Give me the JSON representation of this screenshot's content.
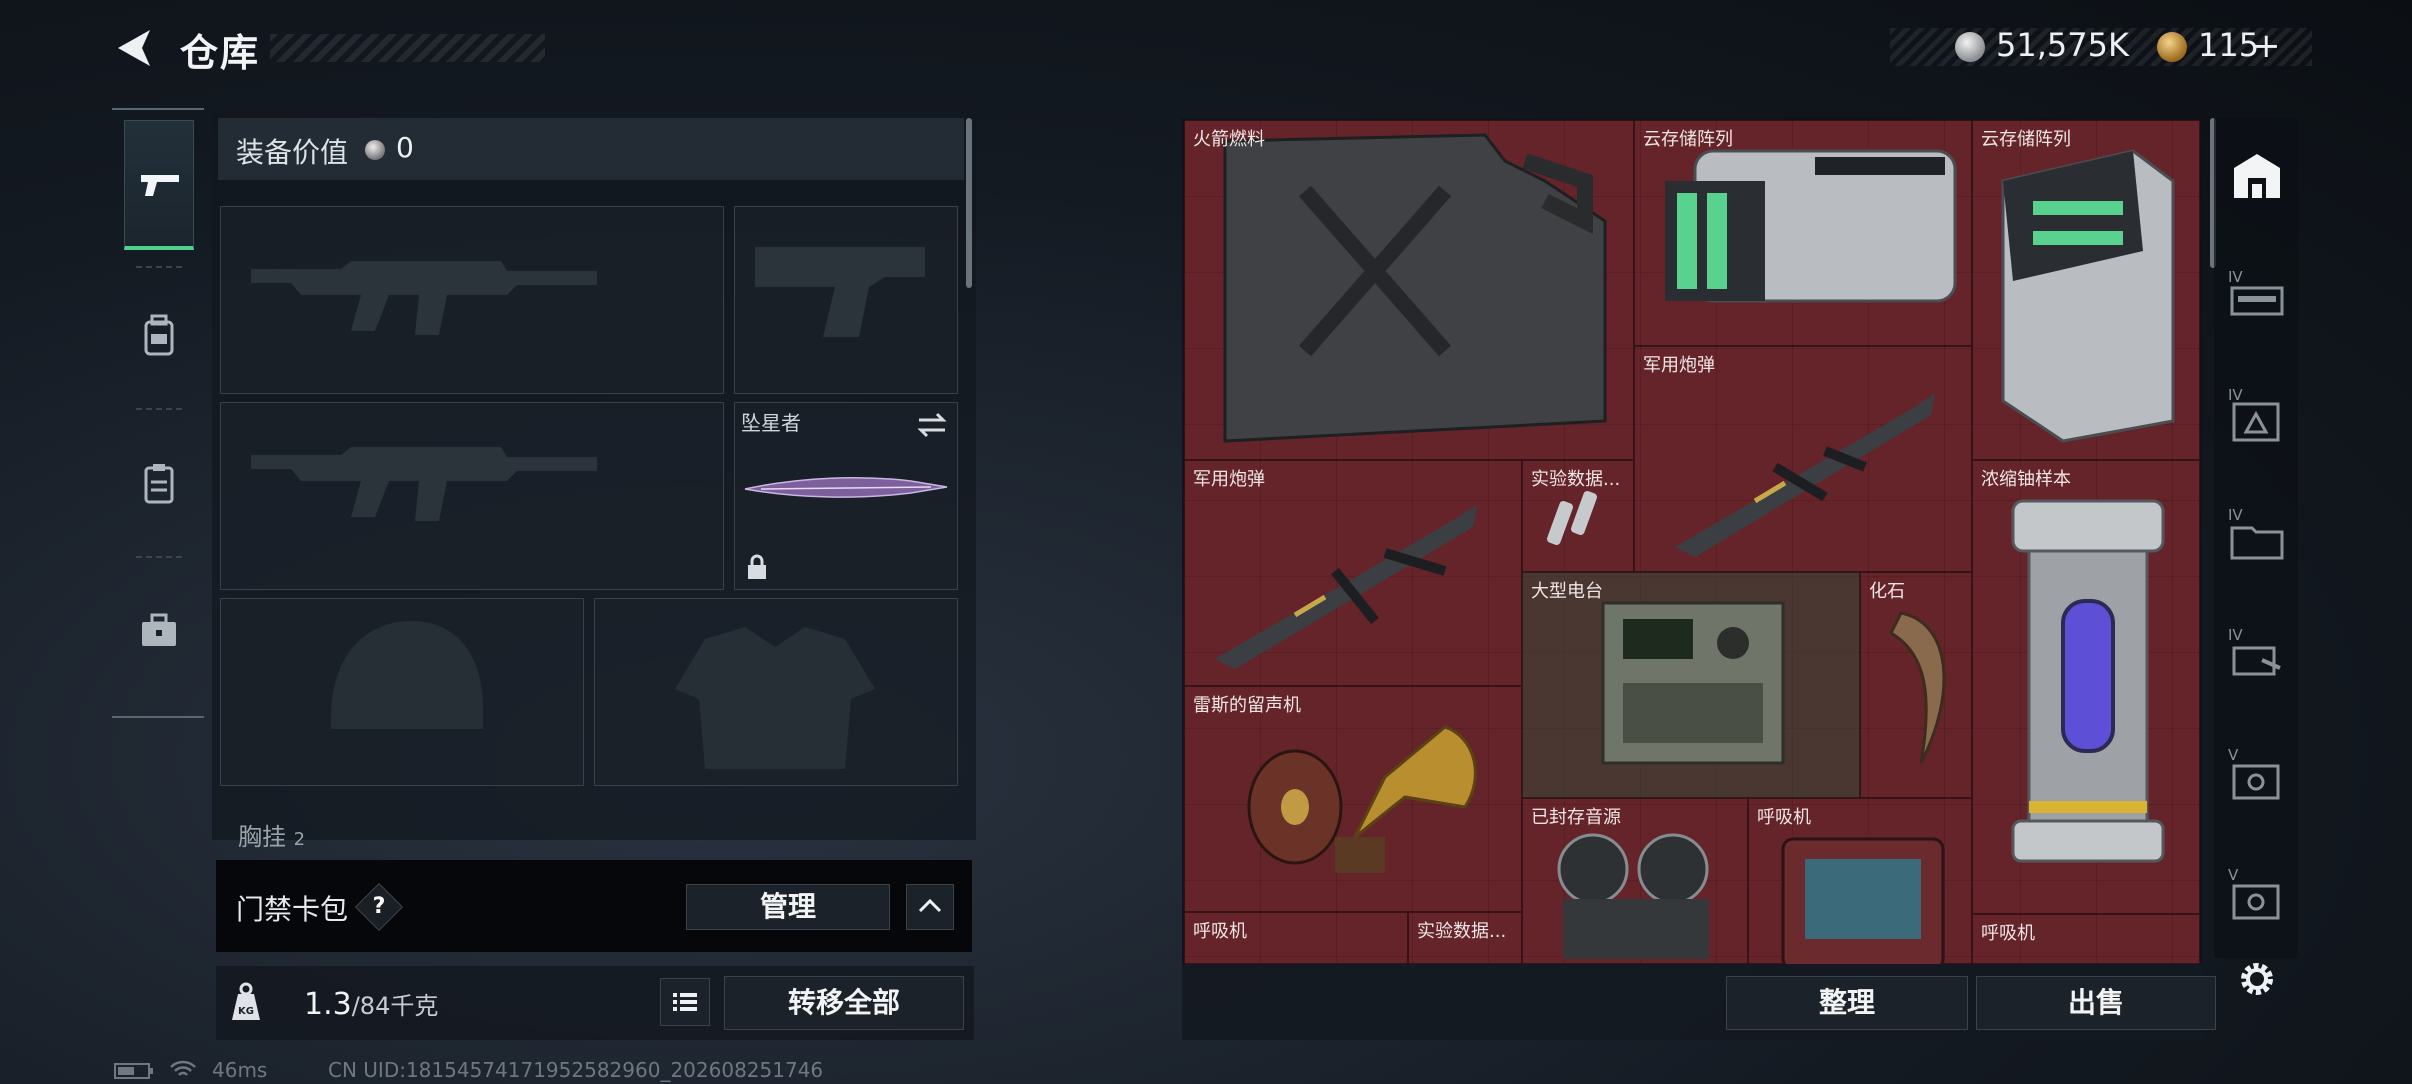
{
  "header": {
    "title": "仓库",
    "currency_silver": "51,575K",
    "currency_gold": "115",
    "gold_plus": "+"
  },
  "rail": {
    "tabs": [
      {
        "icon": "pistol-icon",
        "active": true
      },
      {
        "icon": "backpack-icon",
        "active": false
      },
      {
        "icon": "clipboard-icon",
        "active": false
      },
      {
        "icon": "toolbox-icon",
        "active": false
      }
    ]
  },
  "equipment": {
    "value_label": "装备价值",
    "value": "0",
    "melee_name": "坠星者",
    "chest_label": "胸挂",
    "chest_count": "2",
    "slots": [
      "primary-weapon-1",
      "sidearm",
      "primary-weapon-2",
      "melee",
      "helmet",
      "armor"
    ]
  },
  "access_card": {
    "label": "门禁卡包",
    "help": "?",
    "manage_label": "管理"
  },
  "weight": {
    "current": "1.3",
    "max_unit": "/84千克",
    "kg_icon_text": "KG",
    "transfer_label": "转移全部"
  },
  "storage": {
    "items": [
      {
        "name": "火箭燃料",
        "icon": "fuel-can-icon"
      },
      {
        "name": "云存储阵列",
        "icon": "server-array-icon"
      },
      {
        "name": "云存储阵列",
        "icon": "server-tower-icon"
      },
      {
        "name": "军用炮弹",
        "icon": "missile-icon"
      },
      {
        "name": "军用炮弹",
        "icon": "missile-icon"
      },
      {
        "name": "实验数据...",
        "icon": "data-cylinders-icon"
      },
      {
        "name": "浓缩铀样本",
        "icon": "uranium-canister-icon"
      },
      {
        "name": "大型电台",
        "icon": "radio-station-icon"
      },
      {
        "name": "化石",
        "icon": "fossil-claw-icon"
      },
      {
        "name": "雷斯的留声机",
        "icon": "gramophone-icon"
      },
      {
        "name": "已封存音源",
        "icon": "reel-tape-icon"
      },
      {
        "name": "呼吸机",
        "icon": "ventilator-icon"
      },
      {
        "name": "呼吸机",
        "icon": "ventilator-icon"
      },
      {
        "name": "实验数据...",
        "icon": "data-cylinders-icon"
      },
      {
        "name": "呼吸机",
        "icon": "ventilator-icon"
      }
    ],
    "sort_label": "整理",
    "sell_label": "出售"
  },
  "side_tabs": [
    {
      "roman": "",
      "icon": "storage-home-icon"
    },
    {
      "roman": "IV",
      "icon": "rifle-case-icon"
    },
    {
      "roman": "IV",
      "icon": "triangle-box-icon"
    },
    {
      "roman": "IV",
      "icon": "folder-icon"
    },
    {
      "roman": "IV",
      "icon": "hand-tool-icon"
    },
    {
      "roman": "V",
      "icon": "safe-icon"
    },
    {
      "roman": "V",
      "icon": "safe-icon"
    }
  ],
  "status": {
    "ping": "46ms",
    "uid": "CN UID:181545741719525829​60_202608251746"
  }
}
